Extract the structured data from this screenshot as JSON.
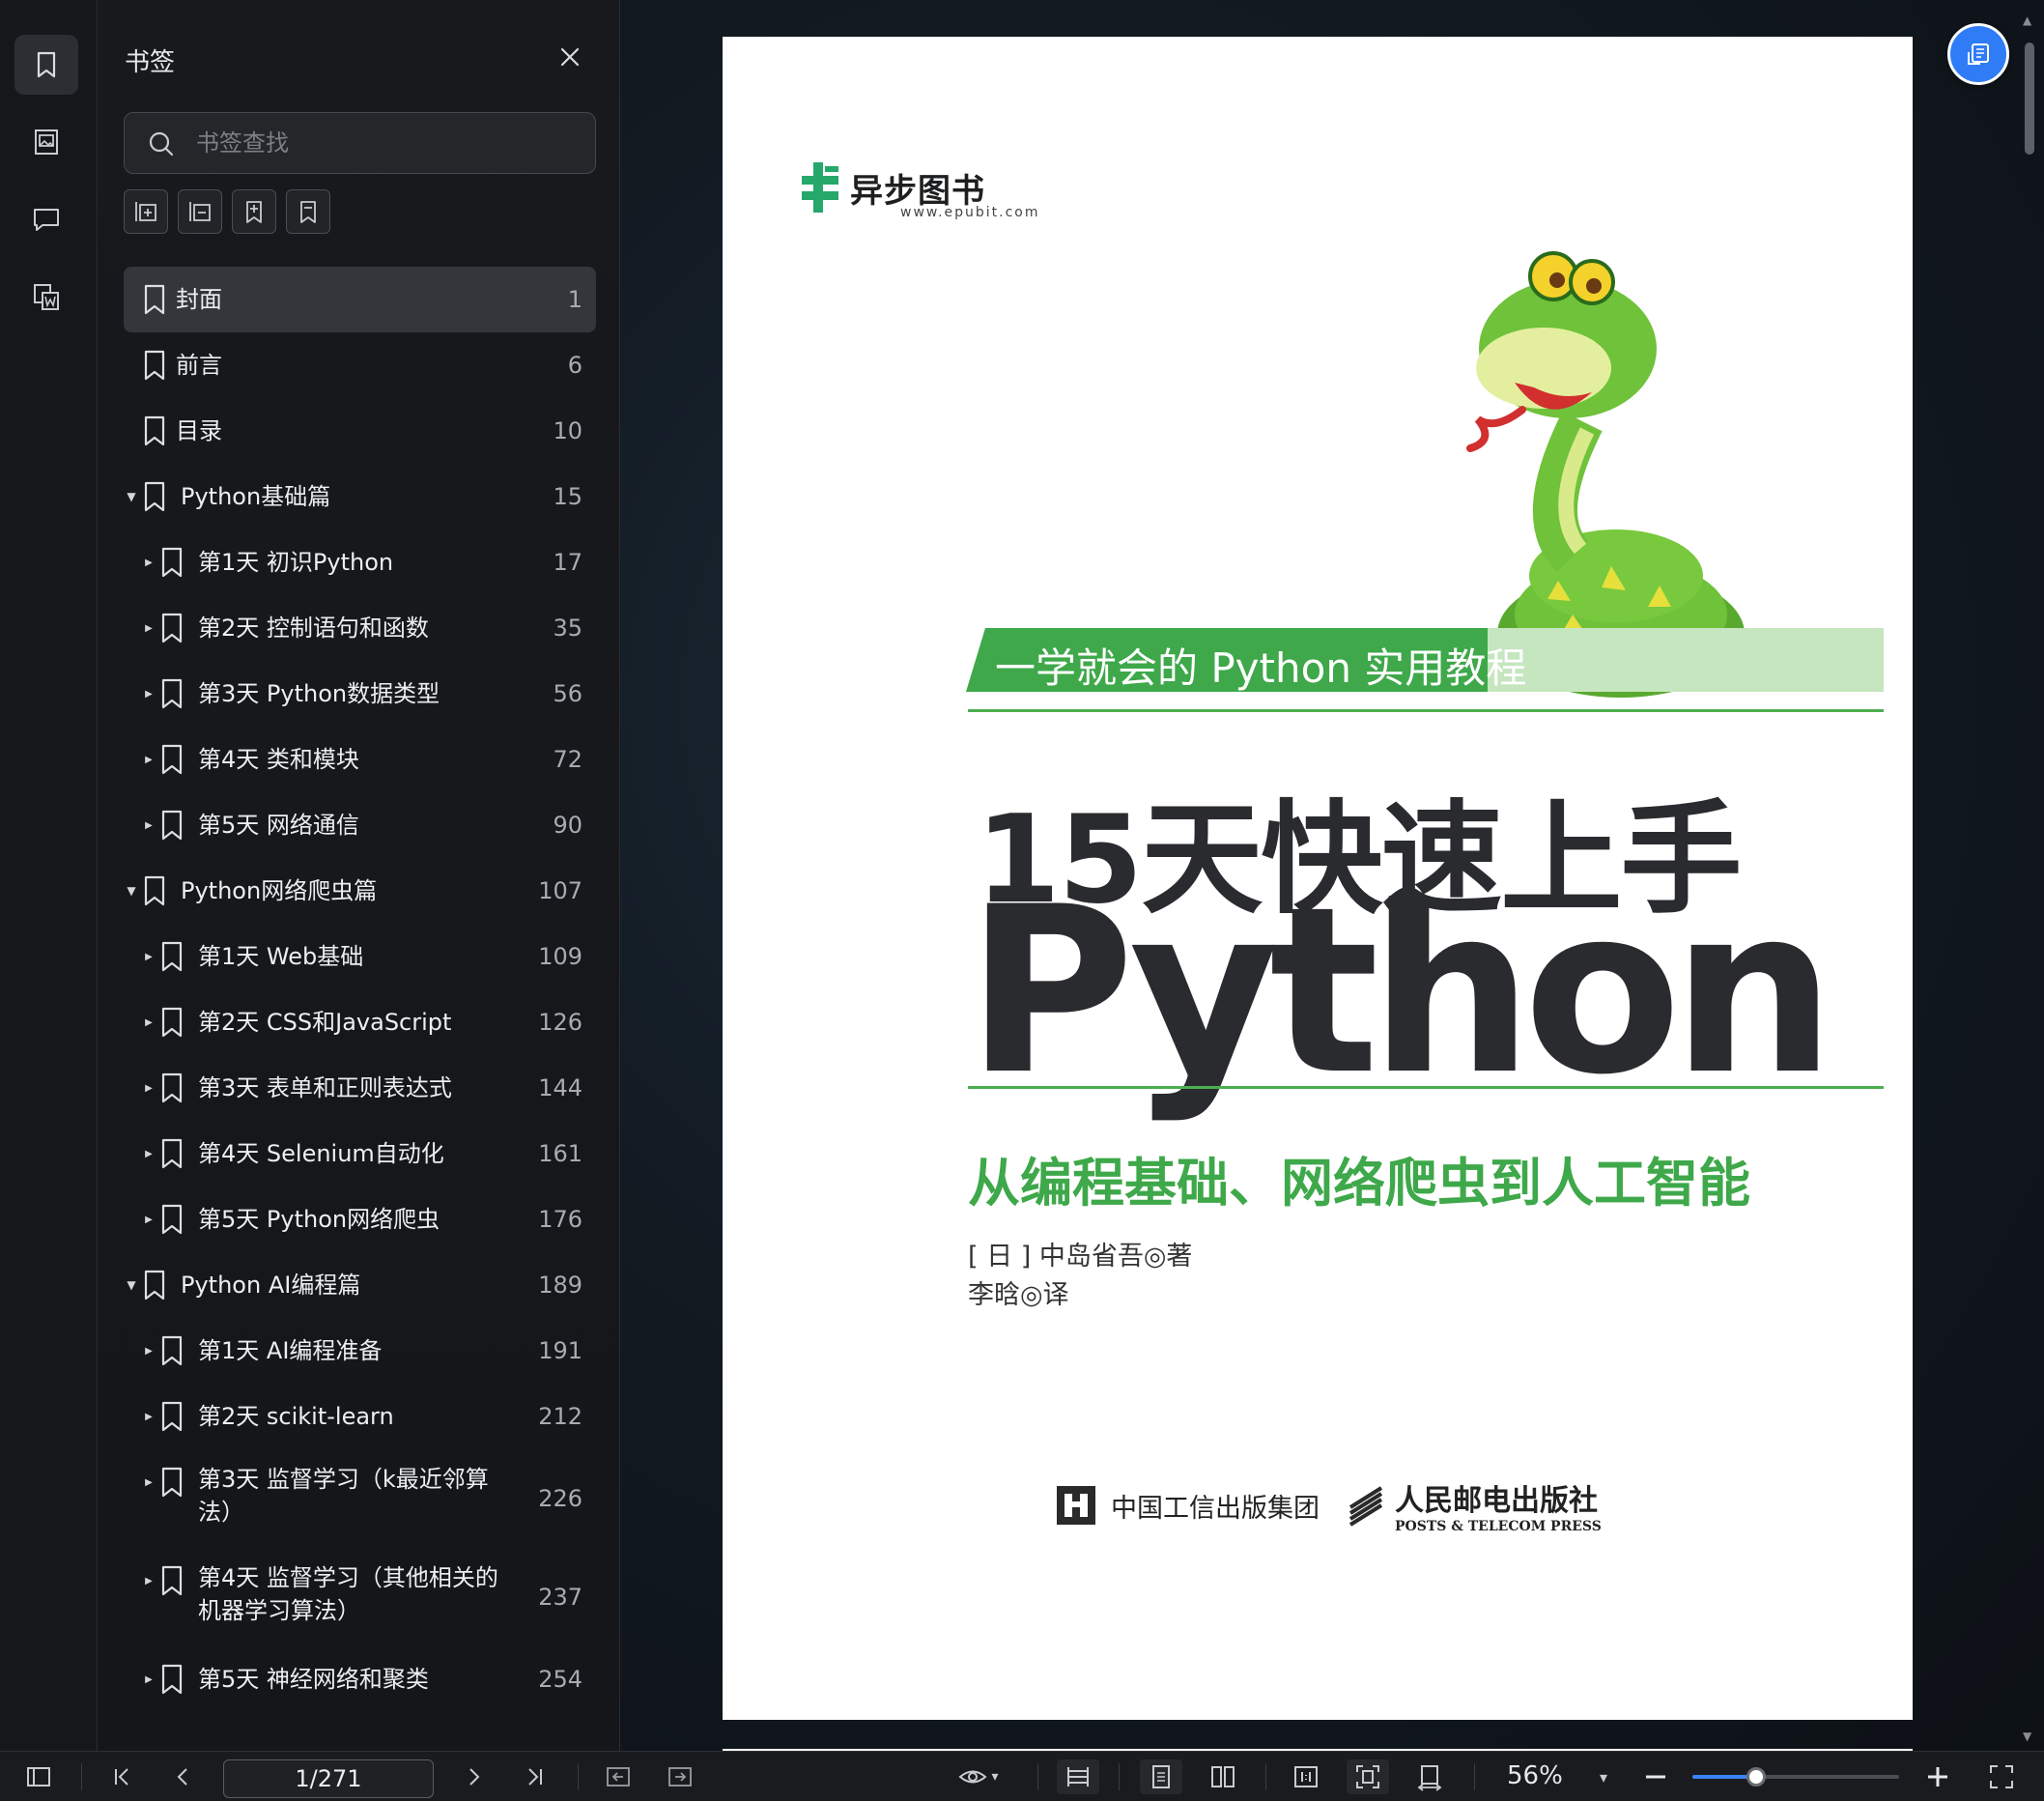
{
  "sidebar": {
    "title": "书签",
    "search_placeholder": "书签查找",
    "items": [
      {
        "label": "封面",
        "page": "1",
        "level": 0,
        "expander": "",
        "selected": true
      },
      {
        "label": "前言",
        "page": "6",
        "level": 0,
        "expander": ""
      },
      {
        "label": "目录",
        "page": "10",
        "level": 0,
        "expander": ""
      },
      {
        "label": "Python基础篇",
        "page": "15",
        "level": 1,
        "expander": "▼"
      },
      {
        "label": "第1天 初识Python",
        "page": "17",
        "level": 2,
        "expander": "▶"
      },
      {
        "label": "第2天 控制语句和函数",
        "page": "35",
        "level": 2,
        "expander": "▶"
      },
      {
        "label": "第3天 Python数据类型",
        "page": "56",
        "level": 2,
        "expander": "▶"
      },
      {
        "label": "第4天 类和模块",
        "page": "72",
        "level": 2,
        "expander": "▶"
      },
      {
        "label": "第5天 网络通信",
        "page": "90",
        "level": 2,
        "expander": "▶"
      },
      {
        "label": "Python网络爬虫篇",
        "page": "107",
        "level": 1,
        "expander": "▼"
      },
      {
        "label": "第1天 Web基础",
        "page": "109",
        "level": 2,
        "expander": "▶"
      },
      {
        "label": "第2天 CSS和JavaScript",
        "page": "126",
        "level": 2,
        "expander": "▶"
      },
      {
        "label": "第3天 表单和正则表达式",
        "page": "144",
        "level": 2,
        "expander": "▶"
      },
      {
        "label": "第4天 Selenium自动化",
        "page": "161",
        "level": 2,
        "expander": "▶"
      },
      {
        "label": "第5天 Python网络爬虫",
        "page": "176",
        "level": 2,
        "expander": "▶"
      },
      {
        "label": "Python AI编程篇",
        "page": "189",
        "level": 1,
        "expander": "▼"
      },
      {
        "label": "第1天 AI编程准备",
        "page": "191",
        "level": 2,
        "expander": "▶"
      },
      {
        "label": "第2天 scikit-learn",
        "page": "212",
        "level": 2,
        "expander": "▶"
      },
      {
        "label": "第3天 监督学习（k最近邻算法）",
        "page": "226",
        "level": 2,
        "expander": "▶",
        "tall": true
      },
      {
        "label": "第4天 监督学习（其他相关的机器学习算法）",
        "page": "237",
        "level": 2,
        "expander": "▶",
        "tall": true
      },
      {
        "label": "第5天 神经网络和聚类",
        "page": "254",
        "level": 2,
        "expander": "▶"
      }
    ]
  },
  "cover": {
    "publisher_logo": "异步图书",
    "publisher_url": "www.epubit.com",
    "series_tagline": "一学就会的 Python 实用教程",
    "title_line1": "15天快速上手",
    "title_line2": "Python",
    "subtitle": "从编程基础、网络爬虫到人工智能",
    "author": "[ 日 ] 中岛省吾◎著",
    "translator": "李晗◎译",
    "publisher1": "中国工信出版集团",
    "publisher2": "人民邮电出版社",
    "publisher2_en": "POSTS & TELECOM PRESS"
  },
  "toolbar": {
    "page_indicator": "1/271",
    "zoom": "56%",
    "zoom_fraction": 0.56
  },
  "colors": {
    "accent": "#3b82f6",
    "cover_green": "#3ea84a",
    "selected_row": "#34363b"
  }
}
